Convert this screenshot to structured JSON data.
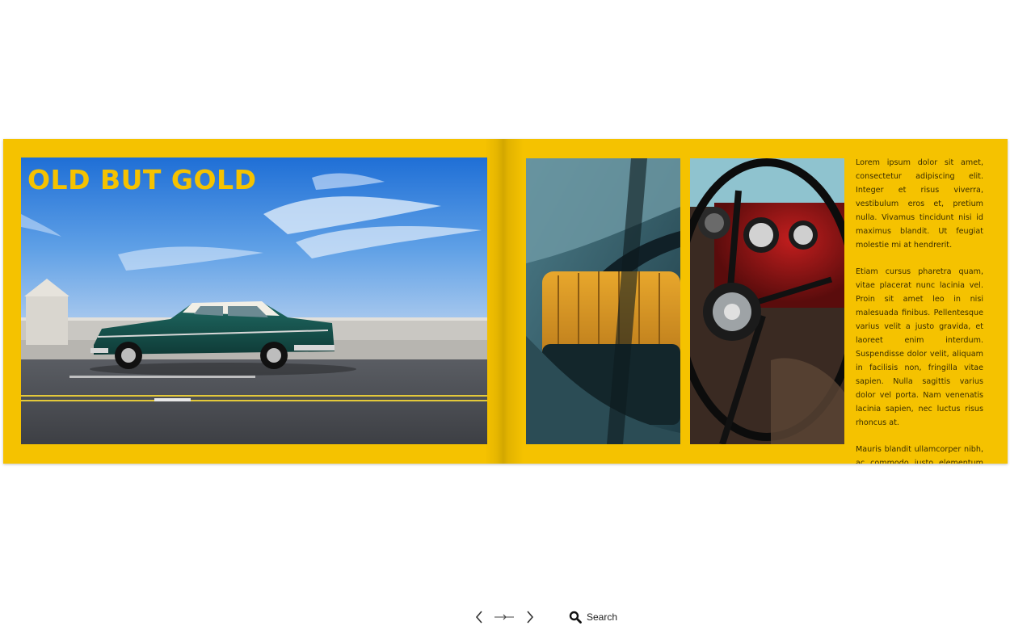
{
  "book": {
    "headline": "OLD BUT GOLD",
    "paragraphs": [
      "Lorem ipsum dolor sit amet, consectetur adipiscing elit. Integer et risus viverra, vestibulum eros et, pretium nulla. Vivamus tincidunt nisi id maximus blandit. Ut feugiat molestie mi at hendrerit.",
      "Etiam cursus pharetra quam, vitae placerat nunc lacinia vel. Proin sit amet leo in nisi malesuada finibus. Pellentesque varius velit a justo gravida, et laoreet enim interdum. Suspendisse dolor velit, aliquam in facilisis non, fringilla vitae sapien. Nulla sagittis varius dolor vel porta. Nam venenatis lacinia sapien, nec luctus risus rhoncus at.",
      "Mauris blandit ullamcorper nibh, ac commodo justo elementum id."
    ],
    "page_color": "#f5c200"
  },
  "toolbar": {
    "prev_icon": "chevron-left-icon",
    "slider_icon": "page-slider-icon",
    "next_icon": "chevron-right-icon",
    "search_icon": "search-icon",
    "search_label": "Search"
  }
}
